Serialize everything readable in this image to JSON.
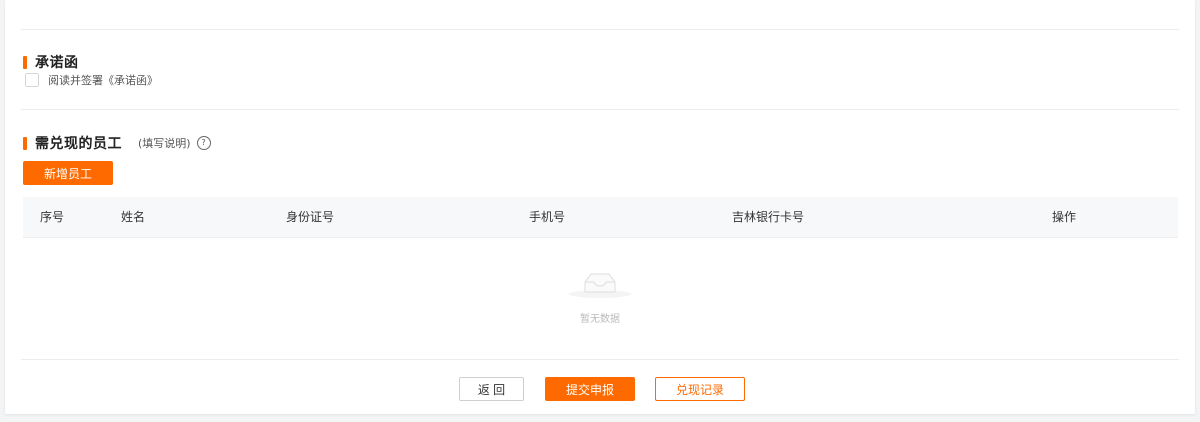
{
  "commitment": {
    "title": "承诺函",
    "agree_label": "阅读并签署《承诺函》",
    "agree_checked": false
  },
  "employees": {
    "title": "需兑现的员工",
    "hint": "(填写说明)",
    "help_icon": "question-circle-icon",
    "add_button": "新增员工",
    "columns": [
      "序号",
      "姓名",
      "身份证号",
      "手机号",
      "吉林银行卡号",
      "操作"
    ],
    "rows": [],
    "empty_text": "暂无数据"
  },
  "actions": {
    "back": "返 回",
    "submit": "提交申报",
    "history": "兑现记录"
  },
  "colors": {
    "accent": "#ff6a00",
    "header_bg": "#f7f8fa",
    "divider": "#ececec"
  }
}
